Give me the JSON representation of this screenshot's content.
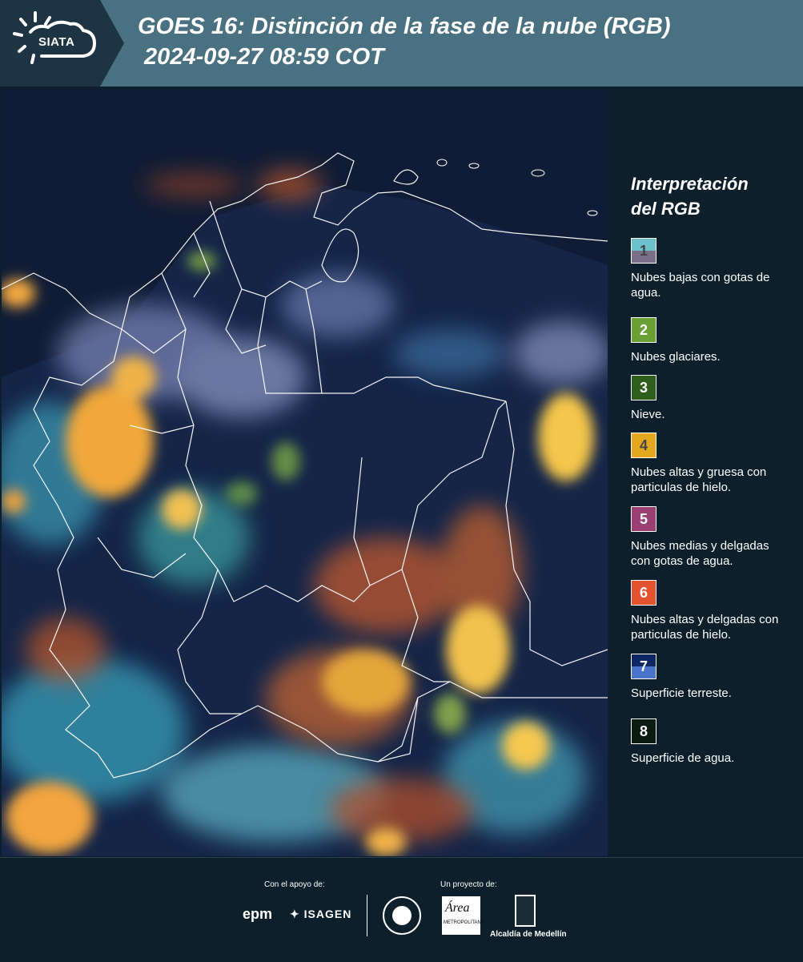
{
  "header": {
    "logo_text": "SIATA",
    "title_line1": "GOES 16: Distinción de la fase de la nube (RGB)",
    "title_line2": " 2024-09-27 08:59 COT"
  },
  "legend": {
    "title_line1": "Interpretación",
    "title_line2": "del RGB",
    "items": [
      {
        "number": "1",
        "label": "Nubes bajas con gotas de agua.",
        "color_top": "#6cc1cc",
        "color_bottom": "#7a6f8a",
        "text_color": "#444444"
      },
      {
        "number": "2",
        "label": "Nubes glaciares.",
        "color_top": "#6aa033",
        "color_bottom": "#6aa033",
        "text_color": "#ffffff"
      },
      {
        "number": "3",
        "label": "Nieve.",
        "color_top": "#2e5e1b",
        "color_bottom": "#2e5e1b",
        "text_color": "#ffffff"
      },
      {
        "number": "4",
        "label": "Nubes altas y gruesa con particulas de hielo.",
        "color_top": "#e3a81f",
        "color_bottom": "#e3a81f",
        "text_color": "#444444"
      },
      {
        "number": "5",
        "label": "Nubes medias y delgadas con gotas de agua.",
        "color_top": "#9a3f72",
        "color_bottom": "#9a3f72",
        "text_color": "#ffffff"
      },
      {
        "number": "6",
        "label": "Nubes altas y delgadas con particulas de hielo.",
        "color_top": "#e4512f",
        "color_bottom": "#e4512f",
        "text_color": "#ffffff"
      },
      {
        "number": "7",
        "label": "Superficie terreste.",
        "color_top": "#0e2663",
        "color_bottom": "#4a74c9",
        "text_color": "#ffffff"
      },
      {
        "number": "8",
        "label": "Superficie de agua.",
        "color_top": "#0b1a12",
        "color_bottom": "#0b1a12",
        "text_color": "#ffffff"
      }
    ]
  },
  "footer": {
    "support_label": "Con el apoyo de:",
    "project_label": "Un proyecto de:",
    "epm": "epm",
    "isagen": "ISAGEN",
    "area_metro": "Área",
    "area_metro_sub": "METROPOLITANA",
    "alcaldia": "Alcaldía de Medellín"
  }
}
